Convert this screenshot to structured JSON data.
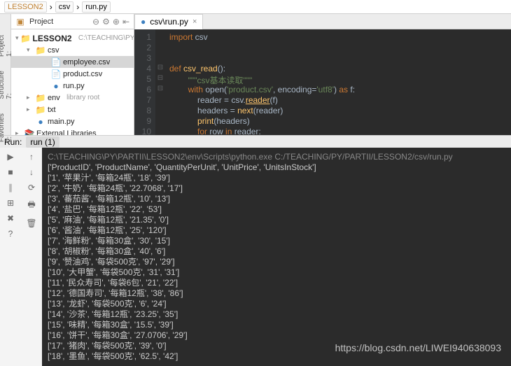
{
  "breadcrumb": {
    "root": "LESSON2",
    "mid": "csv",
    "leaf": "run.py"
  },
  "sidebar": {
    "tab": "Project",
    "root": {
      "name": "LESSON2",
      "path": "C:\\TEACHING\\PY"
    },
    "csv_folder": "csv",
    "files": {
      "employee": "employee.csv",
      "product": "product.csv",
      "run": "run.py"
    },
    "env": "env",
    "env_hint": "library root",
    "txt": "txt",
    "main": "main.py",
    "ext_libs": "External Libraries"
  },
  "gutter": {
    "project": "1: Project",
    "structure": "7: Structure",
    "favorites": "2: Favorites"
  },
  "editor": {
    "tab_label": "csv\\run.py",
    "line_count": 10,
    "line1": "import",
    "line1b": " csv",
    "line4a": "def ",
    "line4b": "csv_read",
    "line4c": "():",
    "line5": "\"\"\"csv基本读取\"\"\"",
    "line6a": "with",
    "line6b": " open(",
    "line6c": "'product.csv'",
    "line6d": ", encoding=",
    "line6e": "'utf8'",
    "line6f": ") ",
    "line6g": "as",
    "line6h": " f:",
    "line7a": "reader = csv.",
    "line7b": "reader",
    "line7c": "(f)",
    "line8a": "headers = ",
    "line8b": "next",
    "line8c": "(reader)",
    "line9a": "print",
    "line9b": "(headers)",
    "line10a": "for",
    "line10b": " row ",
    "line10c": "in",
    "line10d": " reader:"
  },
  "run": {
    "label": "Run:",
    "tab": "run (1)",
    "exec_path": "C:\\TEACHING\\PY\\PARTII\\LESSON2\\env\\Scripts\\python.exe C:/TEACHING/PY/PARTII/LESSON2/csv/run.py",
    "headers": "['ProductID', 'ProductName', 'QuantityPerUnit', 'UnitPrice', 'UnitsInStock']",
    "rows": [
      "['1', '苹果汁', '每箱24瓶', '18', '39']",
      "['2', '牛奶', '每箱24瓶', '22.7068', '17']",
      "['3', '蕃茄酱', '每箱12瓶', '10', '13']",
      "['4', '盐巴', '每箱12瓶', '22', '53']",
      "['5', '麻油', '每箱12瓶', '21.35', '0']",
      "['6', '酱油', '每箱12瓶', '25', '120']",
      "['7', '海鲜粉', '每箱30盒', '30', '15']",
      "['8', '胡椒粉', '每箱30盒', '40', '6']",
      "['9', '赞油鸡', '每袋500克', '97', '29']",
      "['10', '大甲蟹', '每袋500克', '31', '31']",
      "['11', '民众寿司', '每袋6包', '21', '22']",
      "['12', '德国寿司', '每箱12瓶', '38', '86']",
      "['13', '龙虾', '每袋500克', '6', '24']",
      "['14', '沙茶', '每箱12瓶', '23.25', '35']",
      "['15', '味精', '每箱30盒', '15.5', '39']",
      "['16', '饼干', '每箱30盒', '27.0706', '29']",
      "['17', '猪肉', '每袋500克', '39', '0']",
      "['18', '墨鱼', '每袋500克', '62.5', '42']"
    ]
  },
  "watermark": "https://blog.csdn.net/LIWEI940638093"
}
